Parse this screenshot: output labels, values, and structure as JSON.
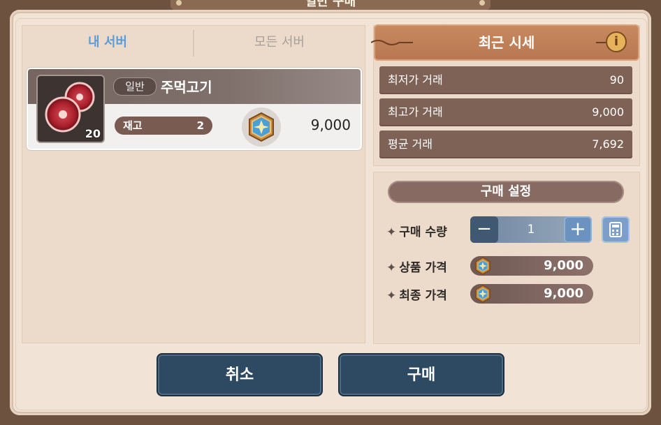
{
  "window": {
    "title": "일반 구매"
  },
  "tabs": {
    "my_server": "내 서버",
    "all_servers": "모든 서버"
  },
  "item": {
    "grade": "일반",
    "name": "주먹고기",
    "quantity_badge": "20",
    "stock_label": "재고",
    "stock_value": "2",
    "price": "9,000",
    "icon": "meat-icon",
    "currency_icon": "gem-coin-icon"
  },
  "market": {
    "title": "최근 시세",
    "rows": [
      {
        "label": "최저가 거래",
        "value": "90"
      },
      {
        "label": "최고가 거래",
        "value": "9,000"
      },
      {
        "label": "평균 거래",
        "value": "7,692"
      }
    ]
  },
  "purchase": {
    "title": "구매 설정",
    "qty_label": "구매 수량",
    "qty_value": "1",
    "item_price_label": "상품 가격",
    "item_price": "9,000",
    "final_price_label": "최종 가격",
    "final_price": "9,000"
  },
  "buttons": {
    "cancel": "취소",
    "buy": "구매"
  },
  "colors": {
    "active_tab": "#5a9bd8",
    "button_bg": "#2e4a62",
    "header_brown": "#b77651"
  }
}
